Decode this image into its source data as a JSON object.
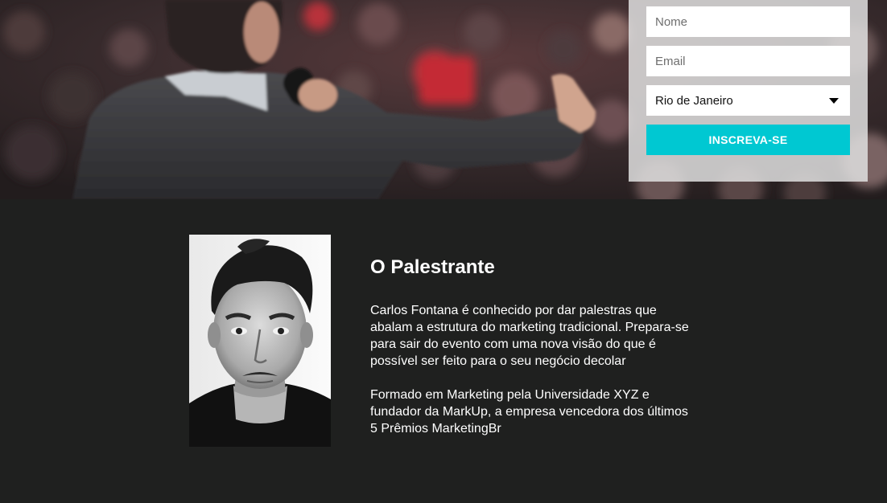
{
  "signup_form": {
    "name_placeholder": "Nome",
    "email_placeholder": "Email",
    "city_selected": "Rio de Janeiro",
    "submit_label": "INSCREVA-SE",
    "accent_color": "#00c8d2"
  },
  "speaker": {
    "title": "O Palestrante",
    "paragraph_1": "Carlos Fontana é conhecido por dar palestras que abalam a estrutura do marketing tradicional. Prepara-se para sair do evento com uma nova visão do que é possível ser feito para o seu negócio decolar",
    "paragraph_2": "Formado em Marketing pela Universidade XYZ e fundador da MarkUp, a empresa vencedora dos últimos 5 Prêmios MarketingBr"
  }
}
